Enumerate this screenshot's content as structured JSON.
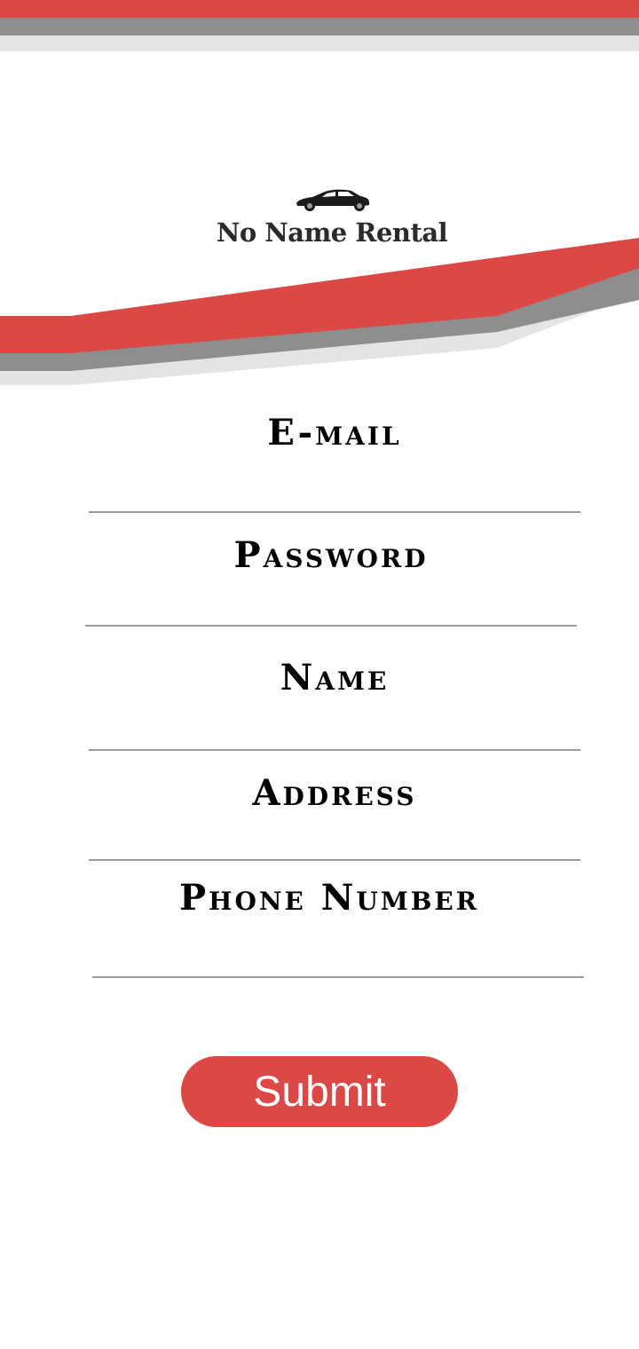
{
  "brand": {
    "name": "No Name Rental",
    "logo_icon": "car-icon"
  },
  "colors": {
    "accent_red": "#dc4845",
    "gray": "#8e8e8e",
    "light_gray": "#e4e4e4"
  },
  "form": {
    "fields": [
      {
        "label": "E-mail",
        "value": "",
        "placeholder": ""
      },
      {
        "label": "Password",
        "value": "",
        "placeholder": ""
      },
      {
        "label": "Name",
        "value": "",
        "placeholder": ""
      },
      {
        "label": "Address",
        "value": "",
        "placeholder": ""
      },
      {
        "label": "Phone Number",
        "value": "",
        "placeholder": ""
      }
    ],
    "submit_label": "Submit"
  }
}
